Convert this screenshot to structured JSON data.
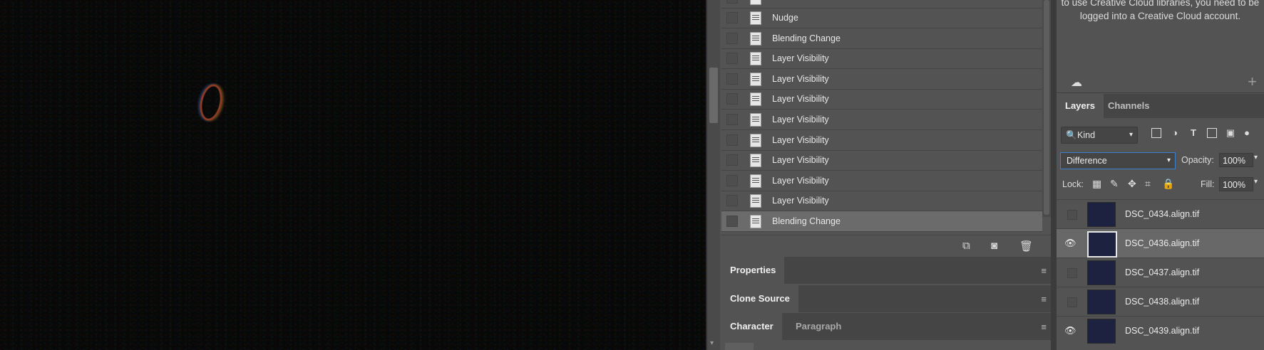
{
  "history": {
    "items": [
      {
        "label": "Nudge"
      },
      {
        "label": "Blending Change"
      },
      {
        "label": "Layer Visibility"
      },
      {
        "label": "Layer Visibility"
      },
      {
        "label": "Layer Visibility"
      },
      {
        "label": "Layer Visibility"
      },
      {
        "label": "Layer Visibility"
      },
      {
        "label": "Layer Visibility"
      },
      {
        "label": "Layer Visibility"
      },
      {
        "label": "Layer Visibility"
      },
      {
        "label": "Blending Change"
      }
    ],
    "selected_index": 10,
    "toolbar_icons": [
      "new-document-from-state-icon",
      "camera-icon",
      "trash-icon"
    ]
  },
  "panels": {
    "properties": "Properties",
    "clone_source": "Clone Source",
    "character": "Character",
    "paragraph": "Paragraph"
  },
  "libraries": {
    "message": "to use Creative Cloud libraries, you need to be logged into a Creative Cloud account."
  },
  "layers_panel": {
    "tab_layers": "Layers",
    "tab_channels": "Channels",
    "filter_kind": "Kind",
    "blend_mode": "Difference",
    "opacity_label": "Opacity:",
    "opacity_value": "100%",
    "lock_label": "Lock:",
    "fill_label": "Fill:",
    "fill_value": "100%",
    "layers": [
      {
        "name": "DSC_0434.align.tif",
        "visible": false,
        "selected": false
      },
      {
        "name": "DSC_0436.align.tif",
        "visible": true,
        "selected": true
      },
      {
        "name": "DSC_0437.align.tif",
        "visible": false,
        "selected": false
      },
      {
        "name": "DSC_0438.align.tif",
        "visible": false,
        "selected": false
      },
      {
        "name": "DSC_0439.align.tif",
        "visible": true,
        "selected": false
      }
    ]
  }
}
